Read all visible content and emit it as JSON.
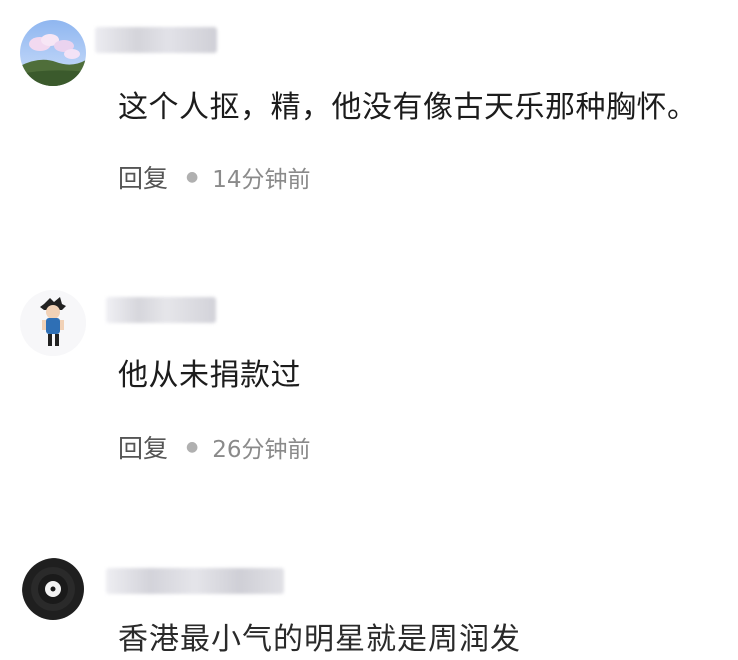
{
  "comments": [
    {
      "text": "这个人抠，精，他没有像古天乐那种胸怀。",
      "reply_label": "回复",
      "time": "14分钟前",
      "avatar_icon": "landscape-avatar-icon"
    },
    {
      "text": "他从未捐款过",
      "reply_label": "回复",
      "time": "26分钟前",
      "avatar_icon": "cartoon-character-avatar-icon"
    },
    {
      "text": "香港最小气的明星就是周润发",
      "avatar_icon": "vinyl-record-avatar-icon"
    }
  ],
  "colors": {
    "text": "#1c1c1c",
    "reply": "#555555",
    "time": "#8a8a8a",
    "blur": "#d9d9de"
  }
}
